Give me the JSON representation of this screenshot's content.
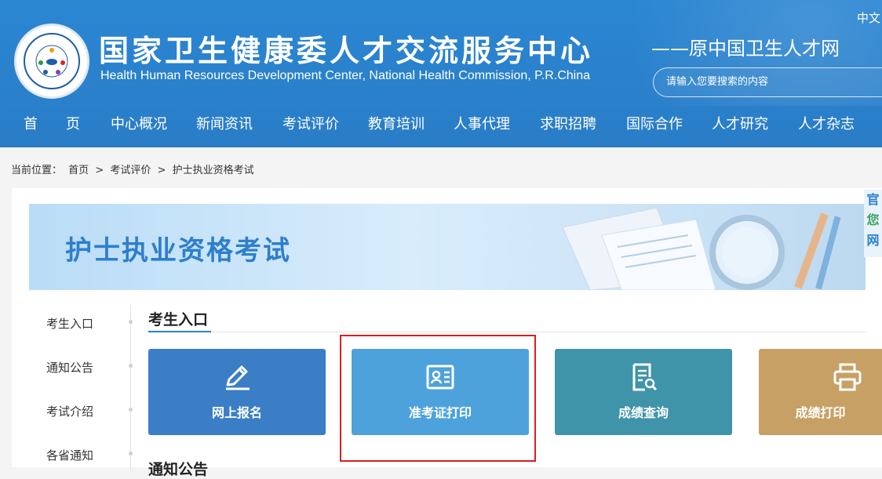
{
  "header": {
    "title_cn": "国家卫生健康委人才交流服务中心",
    "title_en": "Health Human Resources Development Center, National Health Commission, P.R.China",
    "subtitle": "——原中国卫生人才网",
    "lang": "中文",
    "search_placeholder": "请输入您要搜索的内容"
  },
  "nav": [
    {
      "label": "首　　页"
    },
    {
      "label": "中心概况"
    },
    {
      "label": "新闻资讯"
    },
    {
      "label": "考试评价"
    },
    {
      "label": "教育培训"
    },
    {
      "label": "人事代理"
    },
    {
      "label": "求职招聘"
    },
    {
      "label": "国际合作"
    },
    {
      "label": "人才研究"
    },
    {
      "label": "人才杂志"
    }
  ],
  "breadcrumb": {
    "prefix": "当前位置：",
    "items": [
      "首页",
      "考试评价",
      "护士执业资格考试"
    ],
    "sep": ">"
  },
  "banner": {
    "title": "护士执业资格考试"
  },
  "sidebar": {
    "items": [
      {
        "label": "考生入口"
      },
      {
        "label": "通知公告"
      },
      {
        "label": "考试介绍"
      },
      {
        "label": "各省通知"
      }
    ]
  },
  "section": {
    "title": "考生入口",
    "next_title": "通知公告"
  },
  "tiles": [
    {
      "label": "网上报名",
      "color": "#3b7ec6",
      "icon": "pencil-icon"
    },
    {
      "label": "准考证打印",
      "color": "#4ea2dc",
      "icon": "id-card-icon"
    },
    {
      "label": "成绩查询",
      "color": "#3f94a9",
      "icon": "document-search-icon"
    },
    {
      "label": "成绩打印",
      "color": "#c7a065",
      "icon": "printer-icon"
    }
  ],
  "float_panel": {
    "chars": [
      "官",
      "您",
      "网"
    ]
  }
}
